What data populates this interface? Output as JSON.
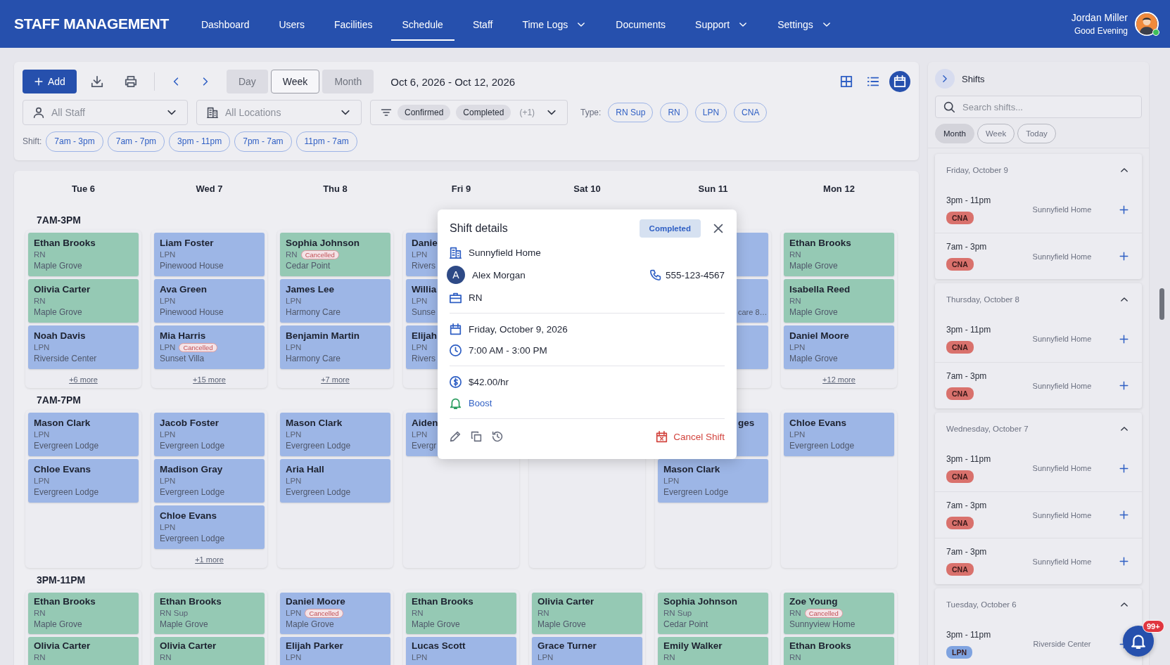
{
  "header": {
    "brand": "STAFF MANAGEMENT",
    "nav": [
      {
        "label": "Dashboard",
        "selected": false,
        "menu": false
      },
      {
        "label": "Users",
        "selected": false,
        "menu": false
      },
      {
        "label": "Facilities",
        "selected": false,
        "menu": false
      },
      {
        "label": "Schedule",
        "selected": true,
        "menu": false
      },
      {
        "label": "Staff",
        "selected": false,
        "menu": false
      },
      {
        "label": "Time Logs",
        "selected": false,
        "menu": true
      },
      {
        "label": "Documents",
        "selected": false,
        "menu": false
      },
      {
        "label": "Support",
        "selected": false,
        "menu": true
      },
      {
        "label": "Settings",
        "selected": false,
        "menu": true
      }
    ],
    "user": {
      "name": "Jordan Miller",
      "greeting": "Good Evening",
      "online": true
    }
  },
  "toolbar": {
    "add": "Add",
    "views": [
      {
        "label": "Day",
        "selected": false
      },
      {
        "label": "Week",
        "selected": true
      },
      {
        "label": "Month",
        "selected": false
      }
    ],
    "date_range": "Oct 6, 2026 - Oct 12, 2026",
    "layouts": [
      {
        "kind": "grid",
        "selected": false
      },
      {
        "kind": "list",
        "selected": false
      },
      {
        "kind": "calendar",
        "selected": true
      }
    ],
    "staff_filter": {
      "placeholder": "All Staff"
    },
    "location_filter": {
      "placeholder": "All Locations"
    },
    "status_filter": {
      "chips": [
        "Confirmed",
        "Completed"
      ],
      "extra": "(+1)"
    },
    "type_label": "Type:",
    "types": [
      "RN Sup",
      "RN",
      "LPN",
      "CNA"
    ],
    "shift_label": "Shift:",
    "shifts": [
      "7am - 3pm",
      "7am - 7pm",
      "3pm - 11pm",
      "7pm - 7am",
      "11pm - 7am"
    ]
  },
  "calendar": {
    "days": [
      "Tue 6",
      "Wed 7",
      "Thu 8",
      "Fri 9",
      "Sat 10",
      "Sun 11",
      "Mon 12"
    ],
    "sections": [
      {
        "label": "7AM-3PM",
        "columns": [
          {
            "cards": [
              {
                "kind": "full",
                "name": "Ethan Brooks",
                "role": "RN",
                "location": "Maple Grove",
                "color": "#95c9b4"
              },
              {
                "kind": "full",
                "name": "Olivia Carter",
                "role": "RN",
                "location": "Maple Grove",
                "color": "#95c9b4"
              },
              {
                "kind": "full",
                "name": "Noah Davis",
                "role": "LPN",
                "location": "Riverside Center",
                "color": "#9db6e6"
              }
            ],
            "more": "+6 more"
          },
          {
            "cards": [
              {
                "kind": "full",
                "name": "Liam Foster",
                "role": "LPN",
                "location": "Pinewood House",
                "color": "#9db6e6"
              },
              {
                "kind": "full",
                "name": "Ava Green",
                "role": "LPN",
                "location": "Pinewood House",
                "color": "#9db6e6"
              },
              {
                "kind": "full",
                "name": "Mia Harris",
                "role": "LPN",
                "badge": "Cancelled",
                "location": "Sunset Villa",
                "color": "#9db6e6"
              }
            ],
            "more": "+15 more"
          },
          {
            "cards": [
              {
                "kind": "full",
                "name": "Sophia Johnson",
                "role": "RN",
                "badge": "Cancelled",
                "location": "Cedar Point",
                "color": "#95c9b4"
              },
              {
                "kind": "full",
                "name": "James Lee",
                "role": "LPN",
                "location": "Harmony Care",
                "color": "#9db6e6"
              },
              {
                "kind": "full",
                "name": "Benjamin Martin",
                "role": "LPN",
                "location": "Harmony Care",
                "color": "#9db6e6"
              }
            ],
            "more": "+7 more"
          },
          {
            "cards": [
              {
                "kind": "full",
                "name": "Danie",
                "role": "LPN",
                "location": "Rivers",
                "color": "#9db6e6"
              },
              {
                "kind": "full",
                "name": "Willia",
                "role": "LPN",
                "location": "Sunse",
                "color": "#9db6e6"
              },
              {
                "kind": "full",
                "name": "Elijah",
                "role": "LPN",
                "location": "Rivers",
                "color": "#9db6e6"
              }
            ]
          },
          null,
          {
            "cards": [
              {
                "kind": "covered",
                "color": "#9db6e6"
              },
              {
                "kind": "covered",
                "location": "care 8…",
                "color": "#9db6e6"
              },
              {
                "kind": "covered",
                "color": "#9db6e6"
              }
            ]
          },
          {
            "cards": [
              {
                "kind": "full",
                "name": "Ethan Brooks",
                "role": "RN",
                "location": "Maple Grove",
                "color": "#95c9b4"
              },
              {
                "kind": "full",
                "name": "Isabella Reed",
                "role": "RN",
                "location": "Maple Grove",
                "color": "#95c9b4"
              },
              {
                "kind": "full",
                "name": "Daniel Moore",
                "role": "LPN",
                "location": "Maple Grove",
                "color": "#9db6e6"
              }
            ],
            "more": "+12 more"
          }
        ]
      },
      {
        "label": "7AM-7PM",
        "columns": [
          {
            "cards": [
              {
                "kind": "full",
                "name": "Mason Clark",
                "role": "LPN",
                "location": "Evergreen Lodge",
                "color": "#9db6e6"
              },
              {
                "kind": "full",
                "name": "Chloe Evans",
                "role": "LPN",
                "location": "Evergreen Lodge",
                "color": "#9db6e6"
              }
            ]
          },
          {
            "cards": [
              {
                "kind": "full",
                "name": "Jacob Foster",
                "role": "LPN",
                "location": "Evergreen Lodge",
                "color": "#9db6e6"
              },
              {
                "kind": "full",
                "name": "Madison Gray",
                "role": "LPN",
                "location": "Evergreen Lodge",
                "color": "#9db6e6"
              },
              {
                "kind": "full",
                "name": "Chloe Evans",
                "role": "LPN",
                "location": "Evergreen Lodge",
                "color": "#9db6e6"
              }
            ],
            "more": "+1 more"
          },
          {
            "cards": [
              {
                "kind": "full",
                "name": "Mason Clark",
                "role": "LPN",
                "location": "Evergreen Lodge",
                "color": "#9db6e6"
              },
              {
                "kind": "full",
                "name": "Aria Hall",
                "role": "LPN",
                "location": "Evergreen Lodge",
                "color": "#9db6e6"
              }
            ]
          },
          {
            "cards": [
              {
                "kind": "full",
                "name": "Aiden",
                "role": "LPN",
                "location": "Evergr",
                "color": "#9db6e6"
              }
            ]
          },
          {},
          {
            "cards": [
              {
                "kind": "covered",
                "name": "ges",
                "color": "#9db6e6"
              },
              {
                "kind": "full",
                "name": "Mason Clark",
                "role": "LPN",
                "location": "Evergreen Lodge",
                "color": "#9db6e6"
              }
            ]
          },
          {
            "cards": [
              {
                "kind": "full",
                "name": "Chloe Evans",
                "role": "LPN",
                "location": "Evergreen Lodge",
                "color": "#9db6e6"
              }
            ]
          }
        ]
      },
      {
        "label": "3PM-11PM",
        "columns": [
          {
            "cards": [
              {
                "kind": "full",
                "name": "Ethan Brooks",
                "role": "RN",
                "location": "Maple Grove",
                "color": "#95c9b4"
              },
              {
                "kind": "full",
                "name": "Olivia Carter",
                "role": "RN",
                "color": "#95c9b4"
              }
            ]
          },
          {
            "cards": [
              {
                "kind": "full",
                "name": "Ethan Brooks",
                "role": "RN Sup",
                "location": "Maple Grove",
                "color": "#95c9b4"
              },
              {
                "kind": "full",
                "name": "Olivia Carter",
                "role": "RN",
                "color": "#95c9b4"
              }
            ]
          },
          {
            "cards": [
              {
                "kind": "full",
                "name": "Daniel Moore",
                "role": "LPN",
                "badge": "Cancelled",
                "location": "Maple Grove",
                "color": "#9db6e6"
              },
              {
                "kind": "full",
                "name": "Elijah Parker",
                "role": "LPN",
                "color": "#9db6e6"
              }
            ]
          },
          {
            "cards": [
              {
                "kind": "full",
                "name": "Ethan Brooks",
                "role": "RN",
                "location": "Maple Grove",
                "color": "#95c9b4"
              },
              {
                "kind": "full",
                "name": "Lucas Scott",
                "role": "LPN",
                "color": "#9db6e6"
              }
            ]
          },
          {
            "cards": [
              {
                "kind": "full",
                "name": "Olivia Carter",
                "role": "RN",
                "location": "Maple Grove",
                "color": "#95c9b4"
              },
              {
                "kind": "full",
                "name": "Grace Turner",
                "role": "LPN",
                "color": "#9db6e6"
              }
            ]
          },
          {
            "cards": [
              {
                "kind": "full",
                "name": "Sophia Johnson",
                "role": "RN Sup",
                "location": "Cedar Point",
                "color": "#95c9b4"
              },
              {
                "kind": "full",
                "name": "Emily Walker",
                "role": "RN",
                "color": "#95c9b4"
              }
            ]
          },
          {
            "cards": [
              {
                "kind": "full",
                "name": "Zoe Young",
                "role": "RN",
                "badge": "Cancelled",
                "location": "Sunnyview Home",
                "color": "#95c9b4"
              },
              {
                "kind": "full",
                "name": "Ethan Brooks",
                "role": "RN",
                "color": "#95c9b4"
              }
            ]
          }
        ]
      }
    ]
  },
  "shift_details": {
    "title": "Shift details",
    "status": "Completed",
    "facility": "Sunnyfield Home",
    "staff": {
      "initial": "A",
      "name": "Alex Morgan",
      "phone": "555-123-4567"
    },
    "role": "RN",
    "date": "Friday, October 9, 2026",
    "time": "7:00 AM - 3:00 PM",
    "rate": "$42.00/hr",
    "boost": "Boost",
    "cancel": "Cancel Shift"
  },
  "sidebar": {
    "title": "Shifts",
    "search": {
      "placeholder": "Search shifts..."
    },
    "ranges": [
      {
        "label": "Month",
        "selected": true
      },
      {
        "label": "Week",
        "selected": false
      },
      {
        "label": "Today",
        "selected": false
      }
    ],
    "groups": [
      {
        "date": "Friday, October 9",
        "expanded": true,
        "shifts": [
          {
            "time": "3pm - 11pm",
            "type": "CNA",
            "color": "#d9716c",
            "facility": "Sunnyfield Home"
          },
          {
            "time": "7am - 3pm",
            "type": "CNA",
            "color": "#d9716c",
            "facility": "Sunnyfield Home"
          }
        ]
      },
      {
        "date": "Thursday, October 8",
        "expanded": true,
        "shifts": [
          {
            "time": "3pm - 11pm",
            "type": "CNA",
            "color": "#d9716c",
            "facility": "Sunnyfield Home"
          },
          {
            "time": "7am - 3pm",
            "type": "CNA",
            "color": "#d9716c",
            "facility": "Sunnyfield Home"
          }
        ]
      },
      {
        "date": "Wednesday, October 7",
        "expanded": true,
        "shifts": [
          {
            "time": "3pm - 11pm",
            "type": "CNA",
            "color": "#d9716c",
            "facility": "Sunnyfield Home"
          },
          {
            "time": "7am - 3pm",
            "type": "CNA",
            "color": "#d9716c",
            "facility": "Sunnyfield Home"
          },
          {
            "time": "7am - 3pm",
            "type": "CNA",
            "color": "#d9716c",
            "facility": "Sunnyfield Home"
          }
        ]
      },
      {
        "date": "Tuesday, October 6",
        "expanded": true,
        "shifts": [
          {
            "time": "3pm - 11pm",
            "type": "LPN",
            "color": "#7fa3e0",
            "facility": "Riverside Center"
          }
        ]
      }
    ]
  },
  "notifications": {
    "count": "99+"
  }
}
